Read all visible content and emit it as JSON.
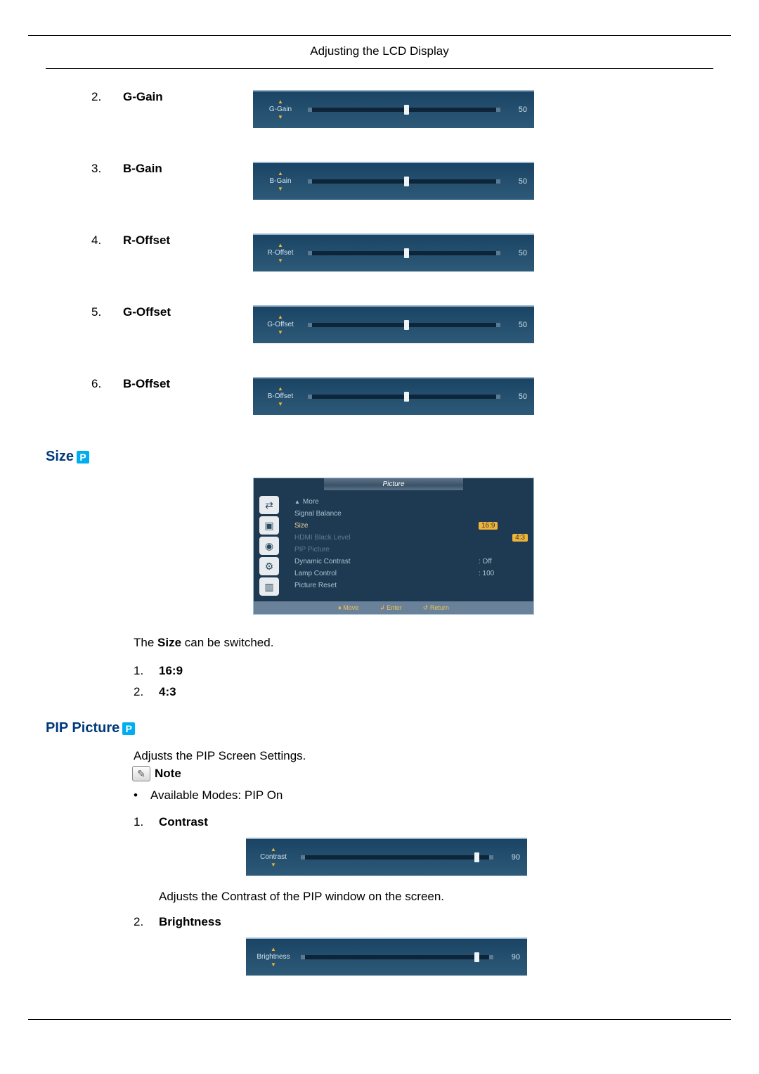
{
  "header": {
    "title": "Adjusting the LCD Display"
  },
  "sliders": [
    {
      "num": "2.",
      "label": "G-Gain",
      "osd_label": "G-Gain",
      "value": "50",
      "thumb_pct": 50
    },
    {
      "num": "3.",
      "label": "B-Gain",
      "osd_label": "B-Gain",
      "value": "50",
      "thumb_pct": 50
    },
    {
      "num": "4.",
      "label": "R-Offset",
      "osd_label": "R-Offset",
      "value": "50",
      "thumb_pct": 50
    },
    {
      "num": "5.",
      "label": "G-Offset",
      "osd_label": "G-Offset",
      "value": "50",
      "thumb_pct": 50
    },
    {
      "num": "6.",
      "label": "B-Offset",
      "osd_label": "B-Offset",
      "value": "50",
      "thumb_pct": 50
    }
  ],
  "size_section": {
    "title": "Size",
    "osd_menu": {
      "title": "Picture",
      "more": "More",
      "items": [
        {
          "label": "Signal Balance",
          "value": ""
        },
        {
          "label": "Size",
          "value": "16:9",
          "hl": true
        },
        {
          "label": "HDMI Black Level",
          "value": "4:3",
          "low": true,
          "hlval": true
        },
        {
          "label": "PIP Picture",
          "value": "",
          "low": true
        },
        {
          "label": "Dynamic Contrast",
          "value": ": Off"
        },
        {
          "label": "Lamp Control",
          "value": ": 100"
        },
        {
          "label": "Picture Reset",
          "value": ""
        }
      ],
      "footer": {
        "move": "Move",
        "enter": "Enter",
        "return": "Return"
      }
    },
    "text_prefix": "The ",
    "text_bold": "Size",
    "text_suffix": " can be switched.",
    "options": [
      {
        "num": "1.",
        "label": "16:9"
      },
      {
        "num": "2.",
        "label": "4:3"
      }
    ]
  },
  "pip_section": {
    "title": "PIP Picture",
    "intro": "Adjusts the PIP Screen Settings.",
    "note_label": "Note",
    "bullet_prefix": "Available Modes: ",
    "bullet_bold": "PIP On",
    "contrast": {
      "num": "1.",
      "label": "Contrast",
      "osd_label": "Contrast",
      "value": "90",
      "thumb_pct": 90,
      "desc": "Adjusts the Contrast of the PIP window on the screen."
    },
    "brightness": {
      "num": "2.",
      "label": "Brightness",
      "osd_label": "Brightness",
      "value": "90",
      "thumb_pct": 90
    }
  }
}
